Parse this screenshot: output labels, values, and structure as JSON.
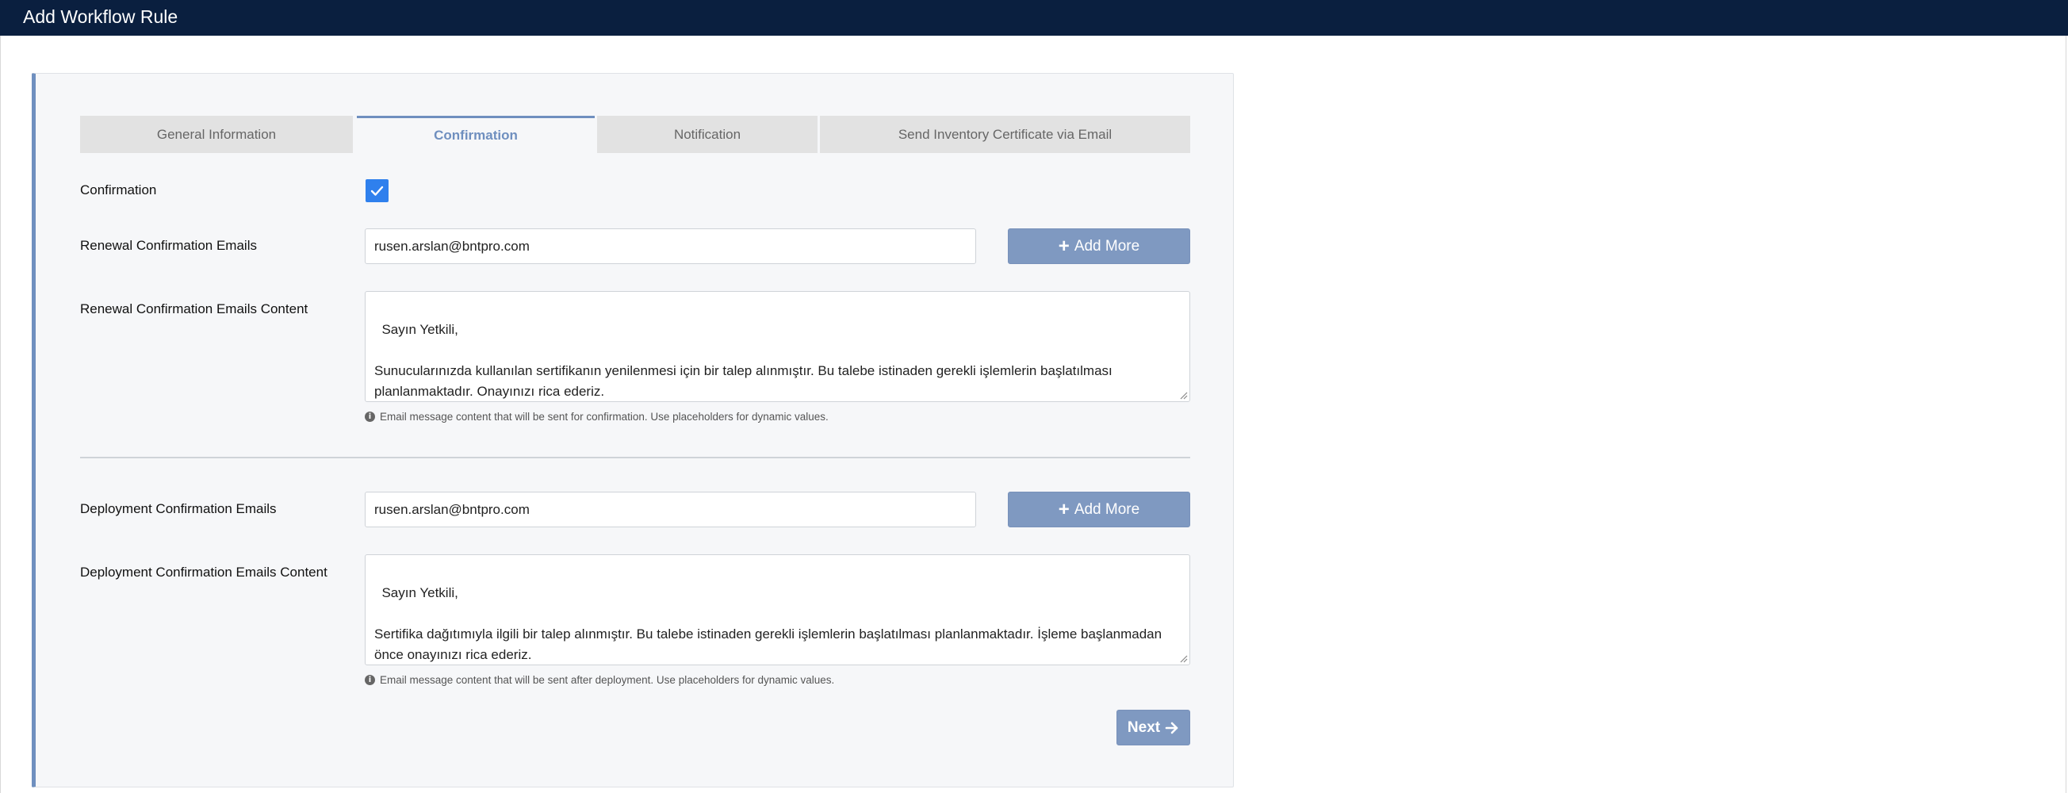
{
  "window": {
    "title": "Add Workflow Rule"
  },
  "tabs": [
    {
      "label": "General Information",
      "active": false
    },
    {
      "label": "Confirmation",
      "active": true
    },
    {
      "label": "Notification",
      "active": false
    },
    {
      "label": "Send Inventory Certificate via Email",
      "active": false
    }
  ],
  "confirmation": {
    "label": "Confirmation",
    "checked": true
  },
  "renewal": {
    "emails_label": "Renewal Confirmation Emails",
    "email_value": "rusen.arslan@bntpro.com",
    "add_more_label": "Add More",
    "content_label": "Renewal Confirmation Emails Content",
    "content_value": "Sayın Yetkili,\n\nSunucularınızda kullanılan sertifikanın yenilenmesi için bir talep alınmıştır. Bu talebe istinaden gerekli işlemlerin başlatılması planlanmaktadır. Onayınızı rica ederiz.",
    "help_text": "Email message content that will be sent for confirmation. Use placeholders for dynamic values."
  },
  "deployment": {
    "emails_label": "Deployment Confirmation Emails",
    "email_value": "rusen.arslan@bntpro.com",
    "add_more_label": "Add More",
    "content_label": "Deployment Confirmation Emails Content",
    "content_value": "Sayın Yetkili,\n\nSertifika dağıtımıyla ilgili bir talep alınmıştır. Bu talebe istinaden gerekli işlemlerin başlatılması planlanmaktadır. İşleme başlanmadan önce onayınızı rica ederiz.",
    "help_text": "Email message content that will be sent after deployment. Use placeholders for dynamic values."
  },
  "footer": {
    "next_label": "Next"
  },
  "colors": {
    "header_bg": "#0a1f3f",
    "accent": "#6f8fbf",
    "button": "#7f99c1",
    "checkbox": "#2f80ed"
  },
  "icons": {
    "plus": "plus-icon",
    "arrow": "arrow-right-icon",
    "check": "check-icon",
    "info": "info-icon"
  }
}
